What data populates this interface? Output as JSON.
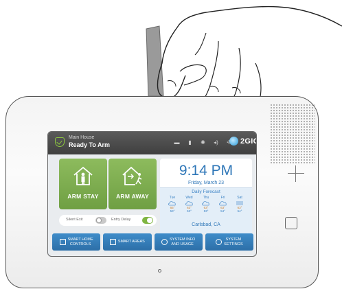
{
  "header": {
    "site_name": "Main House",
    "arm_status": "Ready To Arm",
    "brand": "2GIG",
    "icons": [
      "message-icon",
      "bookmark-icon",
      "brightness-icon",
      "volume-icon",
      "wireless-icon"
    ]
  },
  "arm_buttons": [
    {
      "label": "ARM STAY",
      "icon": "house-person-icon"
    },
    {
      "label": "ARM AWAY",
      "icon": "house-exit-icon"
    }
  ],
  "clock": {
    "time": "9:14 PM",
    "date": "Friday, March 23"
  },
  "forecast": {
    "title": "Daily Forecast",
    "days": [
      {
        "day": "Tue",
        "icon": "cloud-icon",
        "high": "65°",
        "low": "53°"
      },
      {
        "day": "Wed",
        "icon": "cloud-icon",
        "high": "63°",
        "low": "53°"
      },
      {
        "day": "Thu",
        "icon": "cloud-icon",
        "high": "63°",
        "low": "53°"
      },
      {
        "day": "Fri",
        "icon": "cloud-icon",
        "high": "63°",
        "low": "54°"
      },
      {
        "day": "Sat",
        "icon": "fog-icon",
        "high": "63°",
        "low": "54°"
      }
    ],
    "location": "Carlsbad, CA"
  },
  "toggles": [
    {
      "label": "Silent Exit",
      "on": false
    },
    {
      "label": "Entry Delay",
      "on": true
    }
  ],
  "nav_buttons": [
    {
      "line1": "SMART HOME",
      "line2": "CONTROLS",
      "icon": "home-icon"
    },
    {
      "line1": "SMART AREAS",
      "line2": "",
      "icon": "grid-icon"
    },
    {
      "line1": "SYSTEM INFO",
      "line2": "AND USAGE",
      "icon": "info-icon"
    },
    {
      "line1": "SYSTEM",
      "line2": "SETTINGS",
      "icon": "gear-icon"
    }
  ],
  "colors": {
    "arm_green": "#7aab4b",
    "accent_blue": "#2f77b8",
    "button_blue": "#3380bf",
    "status_green": "#8cc63f",
    "header_gray": "#4a4a4a"
  }
}
